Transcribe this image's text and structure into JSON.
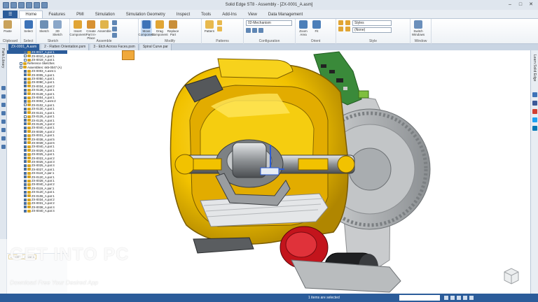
{
  "window": {
    "title": "Solid Edge ST8 - Assembly - [ZX-0001_A.asm]",
    "controls": [
      "–",
      "□",
      "✕"
    ]
  },
  "menu_tabs": [
    "Home",
    "Features",
    "PMI",
    "Simulation",
    "Simulation Geometry",
    "Inspect",
    "Tools",
    "Add-Ins",
    "View",
    "Data Management"
  ],
  "ribbon": {
    "groups": [
      {
        "label": "Clipboard",
        "buttons": [
          "Paste"
        ]
      },
      {
        "label": "Select",
        "buttons": [
          "Select"
        ]
      },
      {
        "label": "Sketch",
        "buttons": [
          "Sketch",
          "3D Sketch"
        ]
      },
      {
        "label": "Assemble",
        "buttons": [
          "Insert Component",
          "Create Part In-Place",
          "Assemble"
        ]
      },
      {
        "label": "Modify",
        "buttons": [
          "Move Component",
          "Drag Component",
          "Replace Part"
        ]
      },
      {
        "label": "Patterns",
        "buttons": [
          "Pattern"
        ]
      },
      {
        "label": "Configuration",
        "buttons": [
          "Configuration"
        ]
      },
      {
        "label": "Orient",
        "buttons": [
          "Zoom Area",
          "Fit"
        ]
      },
      {
        "label": "Style",
        "buttons": [
          "Styles"
        ]
      },
      {
        "label": "Window",
        "buttons": [
          "Switch Windows"
        ]
      }
    ],
    "configuration_value": "02-Mechanism",
    "style_value": "Styles",
    "none_value": "(None)"
  },
  "doc_tabs": [
    "ZX-0001_A.asm",
    "2 - Flatten Orientation.psm",
    "3 - Etch Across Faces.psm",
    "Spiral Curve.par"
  ],
  "left_strip_label": "Parts Library",
  "right_strip_label": "Learn Solid Edge",
  "tree": {
    "rows": [
      {
        "label": "ZX-0017_A.par:1",
        "checked": true,
        "selected": true
      },
      {
        "label": "ZX-0010_A.par:1",
        "checked": false
      },
      {
        "label": "ZX-0019_A.par:1",
        "checked": false
      },
      {
        "label": "Reference Sketches",
        "checked": false,
        "root": true
      },
      {
        "label": "Assemblies: sk5-0047 (A)",
        "checked": false,
        "root": true
      },
      {
        "label": "ZX-0003_A.asm:1",
        "checked": true
      },
      {
        "label": "ZX-0005_A.par:1",
        "checked": true
      },
      {
        "label": "ZX-0050_A.par:1",
        "checked": true
      },
      {
        "label": "ZX-0090_A.par:1",
        "checked": true
      },
      {
        "label": "ZX-0034_A.par:2",
        "checked": true
      },
      {
        "label": "ZX-0138_A.par:1",
        "checked": true
      },
      {
        "label": "ZX-0128_A.par:1",
        "checked": true
      },
      {
        "label": "ZX-0004_A.par:1",
        "checked": true
      },
      {
        "label": "ZX-0002_A.asm:2",
        "checked": true
      },
      {
        "label": "ZX-0102_A.par:1",
        "checked": false
      },
      {
        "label": "ZX-0130_A.par:1",
        "checked": true
      },
      {
        "label": "ZX-0131_A.par:1",
        "checked": true
      },
      {
        "label": "ZX-0126_A.par:1",
        "checked": false
      },
      {
        "label": "ZX-0125_A.par:1",
        "checked": true
      },
      {
        "label": "ZX-0125_A.par:2",
        "checked": true
      },
      {
        "label": "ZX-0040_A.par:1",
        "checked": true
      },
      {
        "label": "ZX-0039_A.par:2",
        "checked": true
      },
      {
        "label": "ZX-0031_A.par:1",
        "checked": true
      },
      {
        "label": "ZX-0038_A.par:5",
        "checked": true
      },
      {
        "label": "ZX-0039_A.par:6",
        "checked": true
      },
      {
        "label": "ZX-0040_A.par:1",
        "checked": true
      },
      {
        "label": "ZX-0029_A.par:1",
        "checked": true
      },
      {
        "label": "ZX-0025_A.par:1",
        "checked": true
      },
      {
        "label": "ZX-0023_A.par:2",
        "checked": true
      },
      {
        "label": "ZX-0025_A.par:3",
        "checked": true
      },
      {
        "label": "ZX-0025_A.par:4",
        "checked": true
      },
      {
        "label": "ZX-0027_A.par:1",
        "checked": true
      },
      {
        "label": "ZX-0119_A.par:1",
        "checked": true
      },
      {
        "label": "ZX-0120_A.par:1",
        "checked": true
      },
      {
        "label": "ZX-0028_A.par:1",
        "checked": true
      },
      {
        "label": "ZX-0040_A.par:2",
        "checked": true
      },
      {
        "label": "ZX-0119_A.par:1",
        "checked": true
      },
      {
        "label": "ZX-0120_A.par:1",
        "checked": true
      },
      {
        "label": "ZX-0106_A.par:1",
        "checked": true
      },
      {
        "label": "ZX-0034_A.par:2",
        "checked": true
      },
      {
        "label": "ZX-0031_A.par:2",
        "checked": true
      },
      {
        "label": "ZX-0038_A.par:4",
        "checked": true
      },
      {
        "label": "ZX-0040_A.par:4",
        "checked": true
      }
    ],
    "preview_label": "ZX-0017_A.par:1"
  },
  "status": {
    "message": "1 items are selected"
  },
  "watermark": {
    "title": "GET INTO PC",
    "subtitle": "Download Free Your Desired App"
  },
  "colors": {
    "accent": "#2b5c9a",
    "housing_yellow": "#f2c200",
    "gear_grey": "#b8bcbf",
    "pcb_green": "#3a8a3a",
    "motor_red": "#c3141c"
  }
}
